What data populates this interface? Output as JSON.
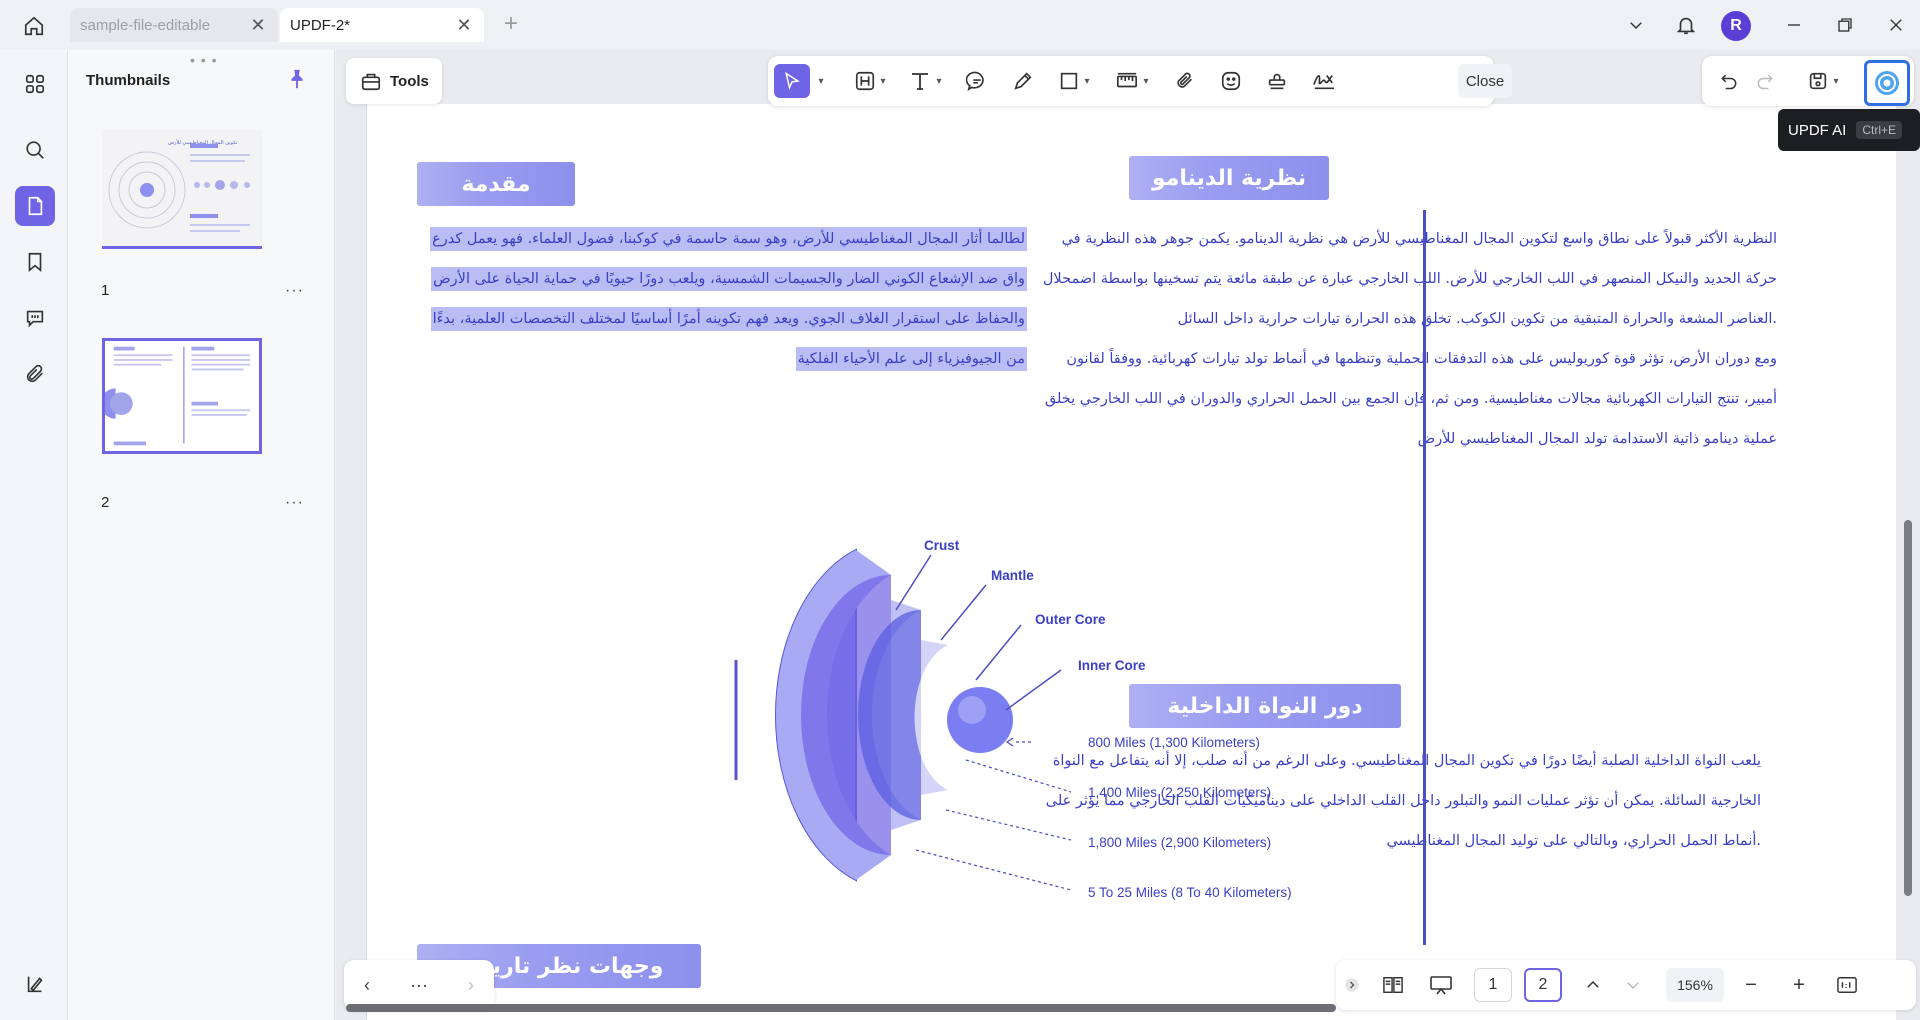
{
  "tabs": [
    {
      "label": "sample-file-editable",
      "close": "✕"
    },
    {
      "label": "UPDF-2*",
      "close": "✕"
    }
  ],
  "new_tab": "+",
  "user": {
    "avatar_letter": "R"
  },
  "thumbnails": {
    "title": "Thumbnails",
    "pages": [
      {
        "number": "1",
        "more": "···",
        "mini_title": "تكوين المجال المغناطيسي للأرض"
      },
      {
        "number": "2",
        "more": "···"
      }
    ]
  },
  "toolbar": {
    "tools_label": "Tools",
    "close_label": "Close",
    "ai_tooltip": "UPDF AI",
    "ai_shortcut": "Ctrl+E"
  },
  "document": {
    "intro": {
      "heading": "مقدمة",
      "lines": [
        "لطالما أثار المجال المغناطيسي للأرض، وهو سمة حاسمة في كوكبنا، فضول العلماء. فهو يعمل كدرع",
        "واق ضد الإشعاع الكوني الضار والجسيمات الشمسية، ويلعب دورًا حيويًا في حماية الحياة على الأرض",
        "والحفاظ على استقرار الغلاف الجوي. ويعد فهم تكوينه أمرًا أساسيًا لمختلف التخصصات العلمية، بدءًا",
        "من الجيوفيزياء إلى علم الأحياء الفلكية"
      ]
    },
    "dynamo": {
      "heading": "نظرية الدينامو",
      "lines": [
        "النظرية الأكثر قبولاً على نطاق واسع لتكوين المجال المغناطيسي للأرض هي نظرية الدينامو. يكمن جوهر هذه النظرية في",
        "حركة الحديد والنيكل المنصهر في اللب الخارجي للأرض. اللب الخارجي عبارة عن طبقة مائعة يتم تسخينها بواسطة اضمحلال",
        ".العناصر المشعة والحرارة المتبقية من تكوين الكوكب. تخلق هذه الحرارة تيارات حرارية داخل السائل",
        "ومع دوران الأرض، تؤثر قوة كوريوليس على هذه التدفقات الحملية وتنظمها في أنماط تولد تيارات كهربائية. ووفقاً لقانون",
        "أمبير، تنتج التيارات الكهربائية مجالات مغناطيسية. ومن ثم، فإن الجمع بين الحمل الحراري والدوران في اللب الخارجي يخلق",
        "عملية دينامو ذاتية الاستدامة تولد المجال المغناطيسي للأرض"
      ]
    },
    "inner_core": {
      "heading": "دور النواة الداخلية",
      "lines": [
        "يلعب النواة الداخلية الصلبة أيضًا دورًا في تكوين المجال المغناطيسي. وعلى الرغم من أنه صلب، إلا أنه يتفاعل مع النواة",
        "الخارجية السائلة. يمكن أن تؤثر عمليات النمو والتبلور داخل القلب الداخلي على ديناميكيات القلب الخارجي مما يؤثر على",
        ".أنماط الحمل الحراري، وبالتالي على توليد المجال المغناطيسي"
      ]
    },
    "historical": {
      "heading": "وجهات نظر تاريخية"
    },
    "diagram": {
      "layers": [
        "Crust",
        "Mantle",
        "Outer Core",
        "Inner Core"
      ],
      "distances": [
        "800 Miles (1,300 Kilometers)",
        "1,400 Miles (2,250 Kilometers)",
        "1,800 Miles (2,900 Kilometers)",
        "5 To 25 Miles (8 To 40 Kilometers)"
      ]
    }
  },
  "bottom_nav": {
    "prev": "‹",
    "more": "···",
    "next": "›"
  },
  "page_bar": {
    "page1": "1",
    "page2": "2",
    "zoom": "156%",
    "zoom_out": "−",
    "zoom_in": "+"
  },
  "colors": {
    "accent": "#6f63e6",
    "heading_bar": "#9a9df0",
    "body_text": "#3a3fc4",
    "highlight": "#b9bdf3",
    "ai_border": "#2f6fe0"
  }
}
